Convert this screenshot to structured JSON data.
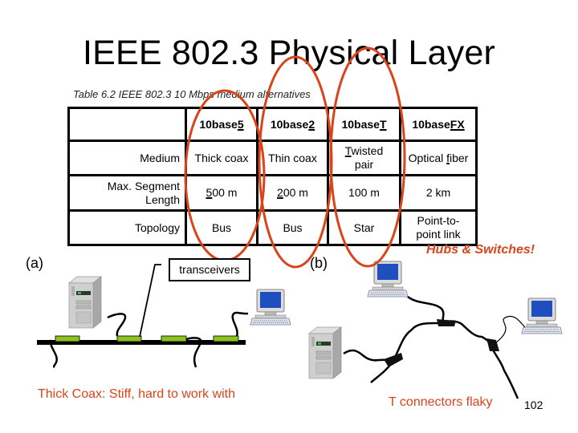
{
  "slide": {
    "title": "IEEE 802.3 Physical Layer",
    "page_number": "102"
  },
  "table": {
    "caption": "Table 6.2  IEEE 802.3 10 Mbps medium alternatives",
    "headers": [
      {
        "prefix": "10base",
        "suffix": "5"
      },
      {
        "prefix": "10base",
        "suffix": "2"
      },
      {
        "prefix": "10base",
        "suffix": "T"
      },
      {
        "prefix": "10base",
        "suffix": "FX"
      }
    ],
    "rows": [
      {
        "label": "Medium",
        "cells": [
          {
            "pre": "",
            "u": "",
            "post": "Thick coax"
          },
          {
            "pre": "",
            "u": "",
            "post": "Thin coax"
          },
          {
            "pre": "",
            "u": "T",
            "post": "wisted pair"
          },
          {
            "pre": "Optical ",
            "u": "f",
            "post": "iber"
          }
        ]
      },
      {
        "label": "Max. Segment Length",
        "cells": [
          {
            "pre": "",
            "u": "5",
            "post": "00 m"
          },
          {
            "pre": "",
            "u": "2",
            "post": "00 m"
          },
          {
            "pre": "",
            "u": "",
            "post": "100 m"
          },
          {
            "pre": "",
            "u": "",
            "post": "2 km"
          }
        ]
      },
      {
        "label": "Topology",
        "cells": [
          {
            "pre": "",
            "u": "",
            "post": "Bus"
          },
          {
            "pre": "",
            "u": "",
            "post": "Bus"
          },
          {
            "pre": "",
            "u": "",
            "post": "Star"
          },
          {
            "pre": "",
            "u": "",
            "post": "Point-to-point link"
          }
        ]
      }
    ],
    "highlight_color": "#d9441a"
  },
  "diagram_a": {
    "label": "(a)",
    "callout": "transceivers",
    "note": "Thick Coax: Stiff, hard to work with",
    "transceiver_color": "#8cc21f"
  },
  "diagram_b": {
    "label": "(b)",
    "callout": "Hubs & Switches!",
    "note": "T connectors flaky"
  },
  "colors": {
    "accent": "#d9441a",
    "screen_blue": "#1f4fbf",
    "case_gray": "#c8c8c8"
  }
}
